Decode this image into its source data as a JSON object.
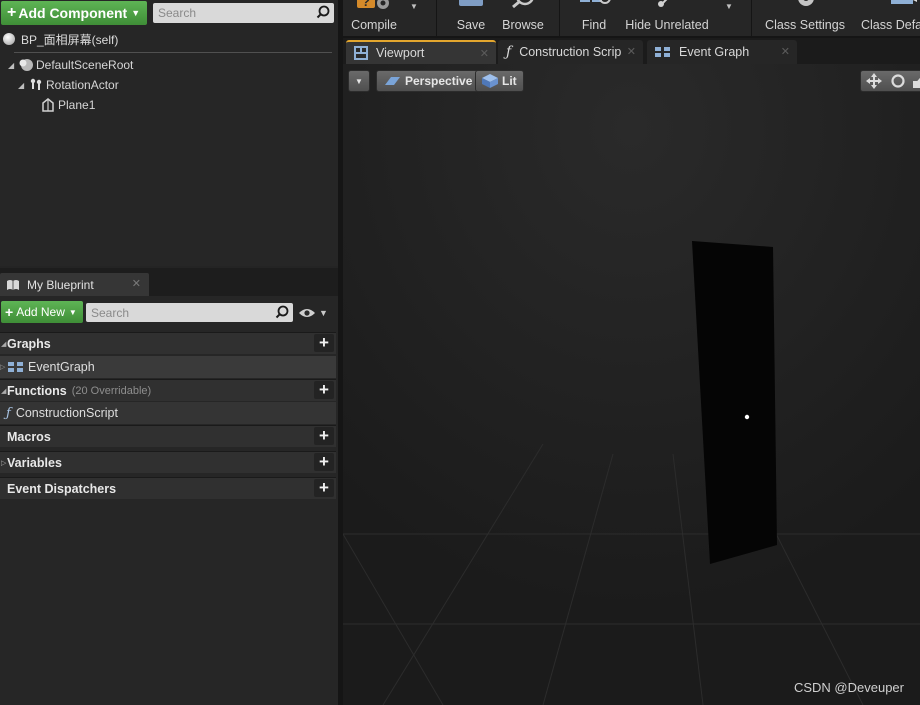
{
  "components_panel": {
    "add_component_label": "Add Component",
    "search_placeholder": "Search",
    "self_label": "BP_面相屏幕(self)",
    "tree": [
      {
        "label": "DefaultSceneRoot",
        "icon": "scene-root-icon"
      },
      {
        "label": "RotationActor",
        "icon": "rotating-movement-icon"
      },
      {
        "label": "Plane1",
        "icon": "static-mesh-icon"
      }
    ]
  },
  "my_blueprint": {
    "tab_label": "My Blueprint",
    "add_new_label": "Add New",
    "search_placeholder": "Search",
    "sections": {
      "graphs": {
        "label": "Graphs",
        "items": [
          "EventGraph"
        ]
      },
      "functions": {
        "label": "Functions",
        "sublabel": "(20 Overridable)",
        "items": [
          "ConstructionScript"
        ]
      },
      "macros": {
        "label": "Macros"
      },
      "variables": {
        "label": "Variables"
      },
      "event_dispatchers": {
        "label": "Event Dispatchers"
      }
    }
  },
  "toolbar": {
    "compile_label": "Compile",
    "save_label": "Save",
    "browse_label": "Browse",
    "find_label": "Find",
    "hide_unrelated_label": "Hide Unrelated",
    "class_settings_label": "Class Settings",
    "class_defaults_label": "Class Defa"
  },
  "doc_tabs": [
    {
      "label": "Viewport",
      "active": true
    },
    {
      "label": "Construction Scrip",
      "active": false
    },
    {
      "label": "Event Graph",
      "active": false
    }
  ],
  "viewport": {
    "perspective_label": "Perspective",
    "lit_label": "Lit",
    "watermark": "CSDN @Deveuper"
  },
  "colors": {
    "accent_green": "#4fa346",
    "active_tab_accent": "#e3a62e",
    "panel_bg": "#262626",
    "viewport_bg": "#202020"
  }
}
